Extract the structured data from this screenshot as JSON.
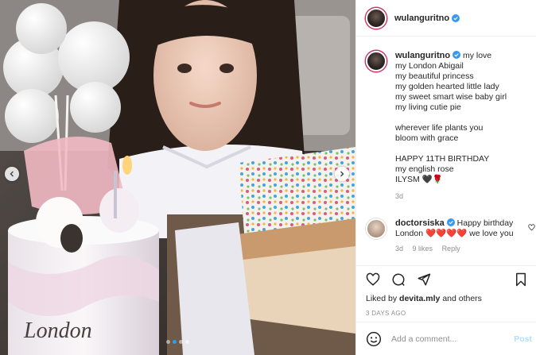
{
  "post": {
    "username": "wulanguritno",
    "caption_lines": [
      "my love",
      "my London Abigail",
      "my beautiful princess",
      "my golden hearted little lady",
      "my sweet smart wise baby girl",
      "my living cutie pie",
      "",
      "wherever life plants you",
      "bloom with grace",
      "",
      "HAPPY 11TH BIRTHDAY",
      "my english rose",
      "ILYSM 🖤🌹"
    ],
    "caption_age": "3d"
  },
  "comment": {
    "username": "doctorsiska",
    "text": "Happy birthday London ❤️❤️❤️❤️ we love you",
    "age": "3d",
    "likes": "9 likes",
    "reply": "Reply"
  },
  "likes_by": "devita.mly",
  "likes_suffix": "and others",
  "likes_prefix": "Liked by",
  "time_ago": "3 DAYS AGO",
  "add_comment": {
    "placeholder": "Add a comment...",
    "post_label": "Post"
  },
  "cake_text": "London",
  "carousel": {
    "count": 4,
    "active": 1
  },
  "colors": {
    "accent": "#0095f6",
    "verified": "#3897f0",
    "heart": "#ed4956"
  },
  "icons": [
    "heart-icon",
    "comment-icon",
    "share-icon",
    "bookmark-icon",
    "emoji-icon",
    "verified-icon",
    "chevron-left-icon",
    "chevron-right-icon"
  ]
}
